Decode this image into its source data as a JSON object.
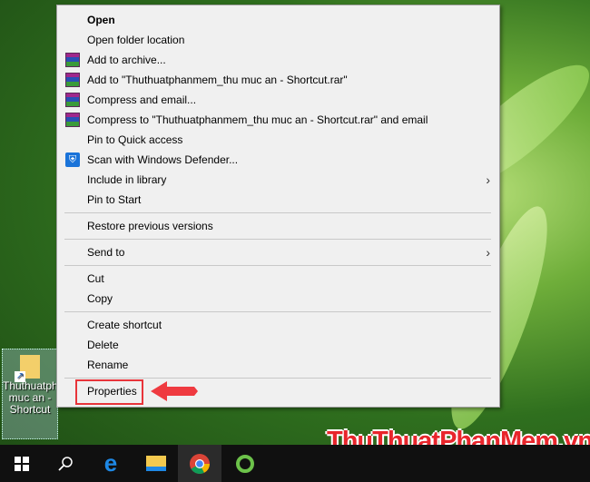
{
  "menu": {
    "items": [
      {
        "label": "Open",
        "icon": null,
        "bold": true
      },
      {
        "label": "Open folder location",
        "icon": null
      },
      {
        "label": "Add to archive...",
        "icon": "winrar-icon"
      },
      {
        "label": "Add to \"Thuthuatphanmem_thu muc an - Shortcut.rar\"",
        "icon": "winrar-icon"
      },
      {
        "label": "Compress and email...",
        "icon": "winrar-icon"
      },
      {
        "label": "Compress to \"Thuthuatphanmem_thu muc an - Shortcut.rar\" and email",
        "icon": "winrar-icon"
      },
      {
        "label": "Pin to Quick access",
        "icon": null
      },
      {
        "label": "Scan with Windows Defender...",
        "icon": "windows-defender-icon"
      },
      {
        "label": "Include in library",
        "icon": null,
        "submenu": true
      },
      {
        "label": "Pin to Start",
        "icon": null
      },
      {
        "label": "Restore previous versions",
        "icon": null
      },
      {
        "label": "Send to",
        "icon": null,
        "submenu": true
      },
      {
        "label": "Cut",
        "icon": null
      },
      {
        "label": "Copy",
        "icon": null
      },
      {
        "label": "Create shortcut",
        "icon": null
      },
      {
        "label": "Delete",
        "icon": null
      },
      {
        "label": "Rename",
        "icon": null
      },
      {
        "label": "Properties",
        "icon": null,
        "highlighted": true
      }
    ]
  },
  "desktop_icon": {
    "label": "Thuthuatphanmem_thu muc an - Shortcut"
  },
  "watermark": "ThuThuatPhanMem.vn",
  "colors": {
    "highlight": "#e8343a",
    "taskbar": "#101010"
  }
}
